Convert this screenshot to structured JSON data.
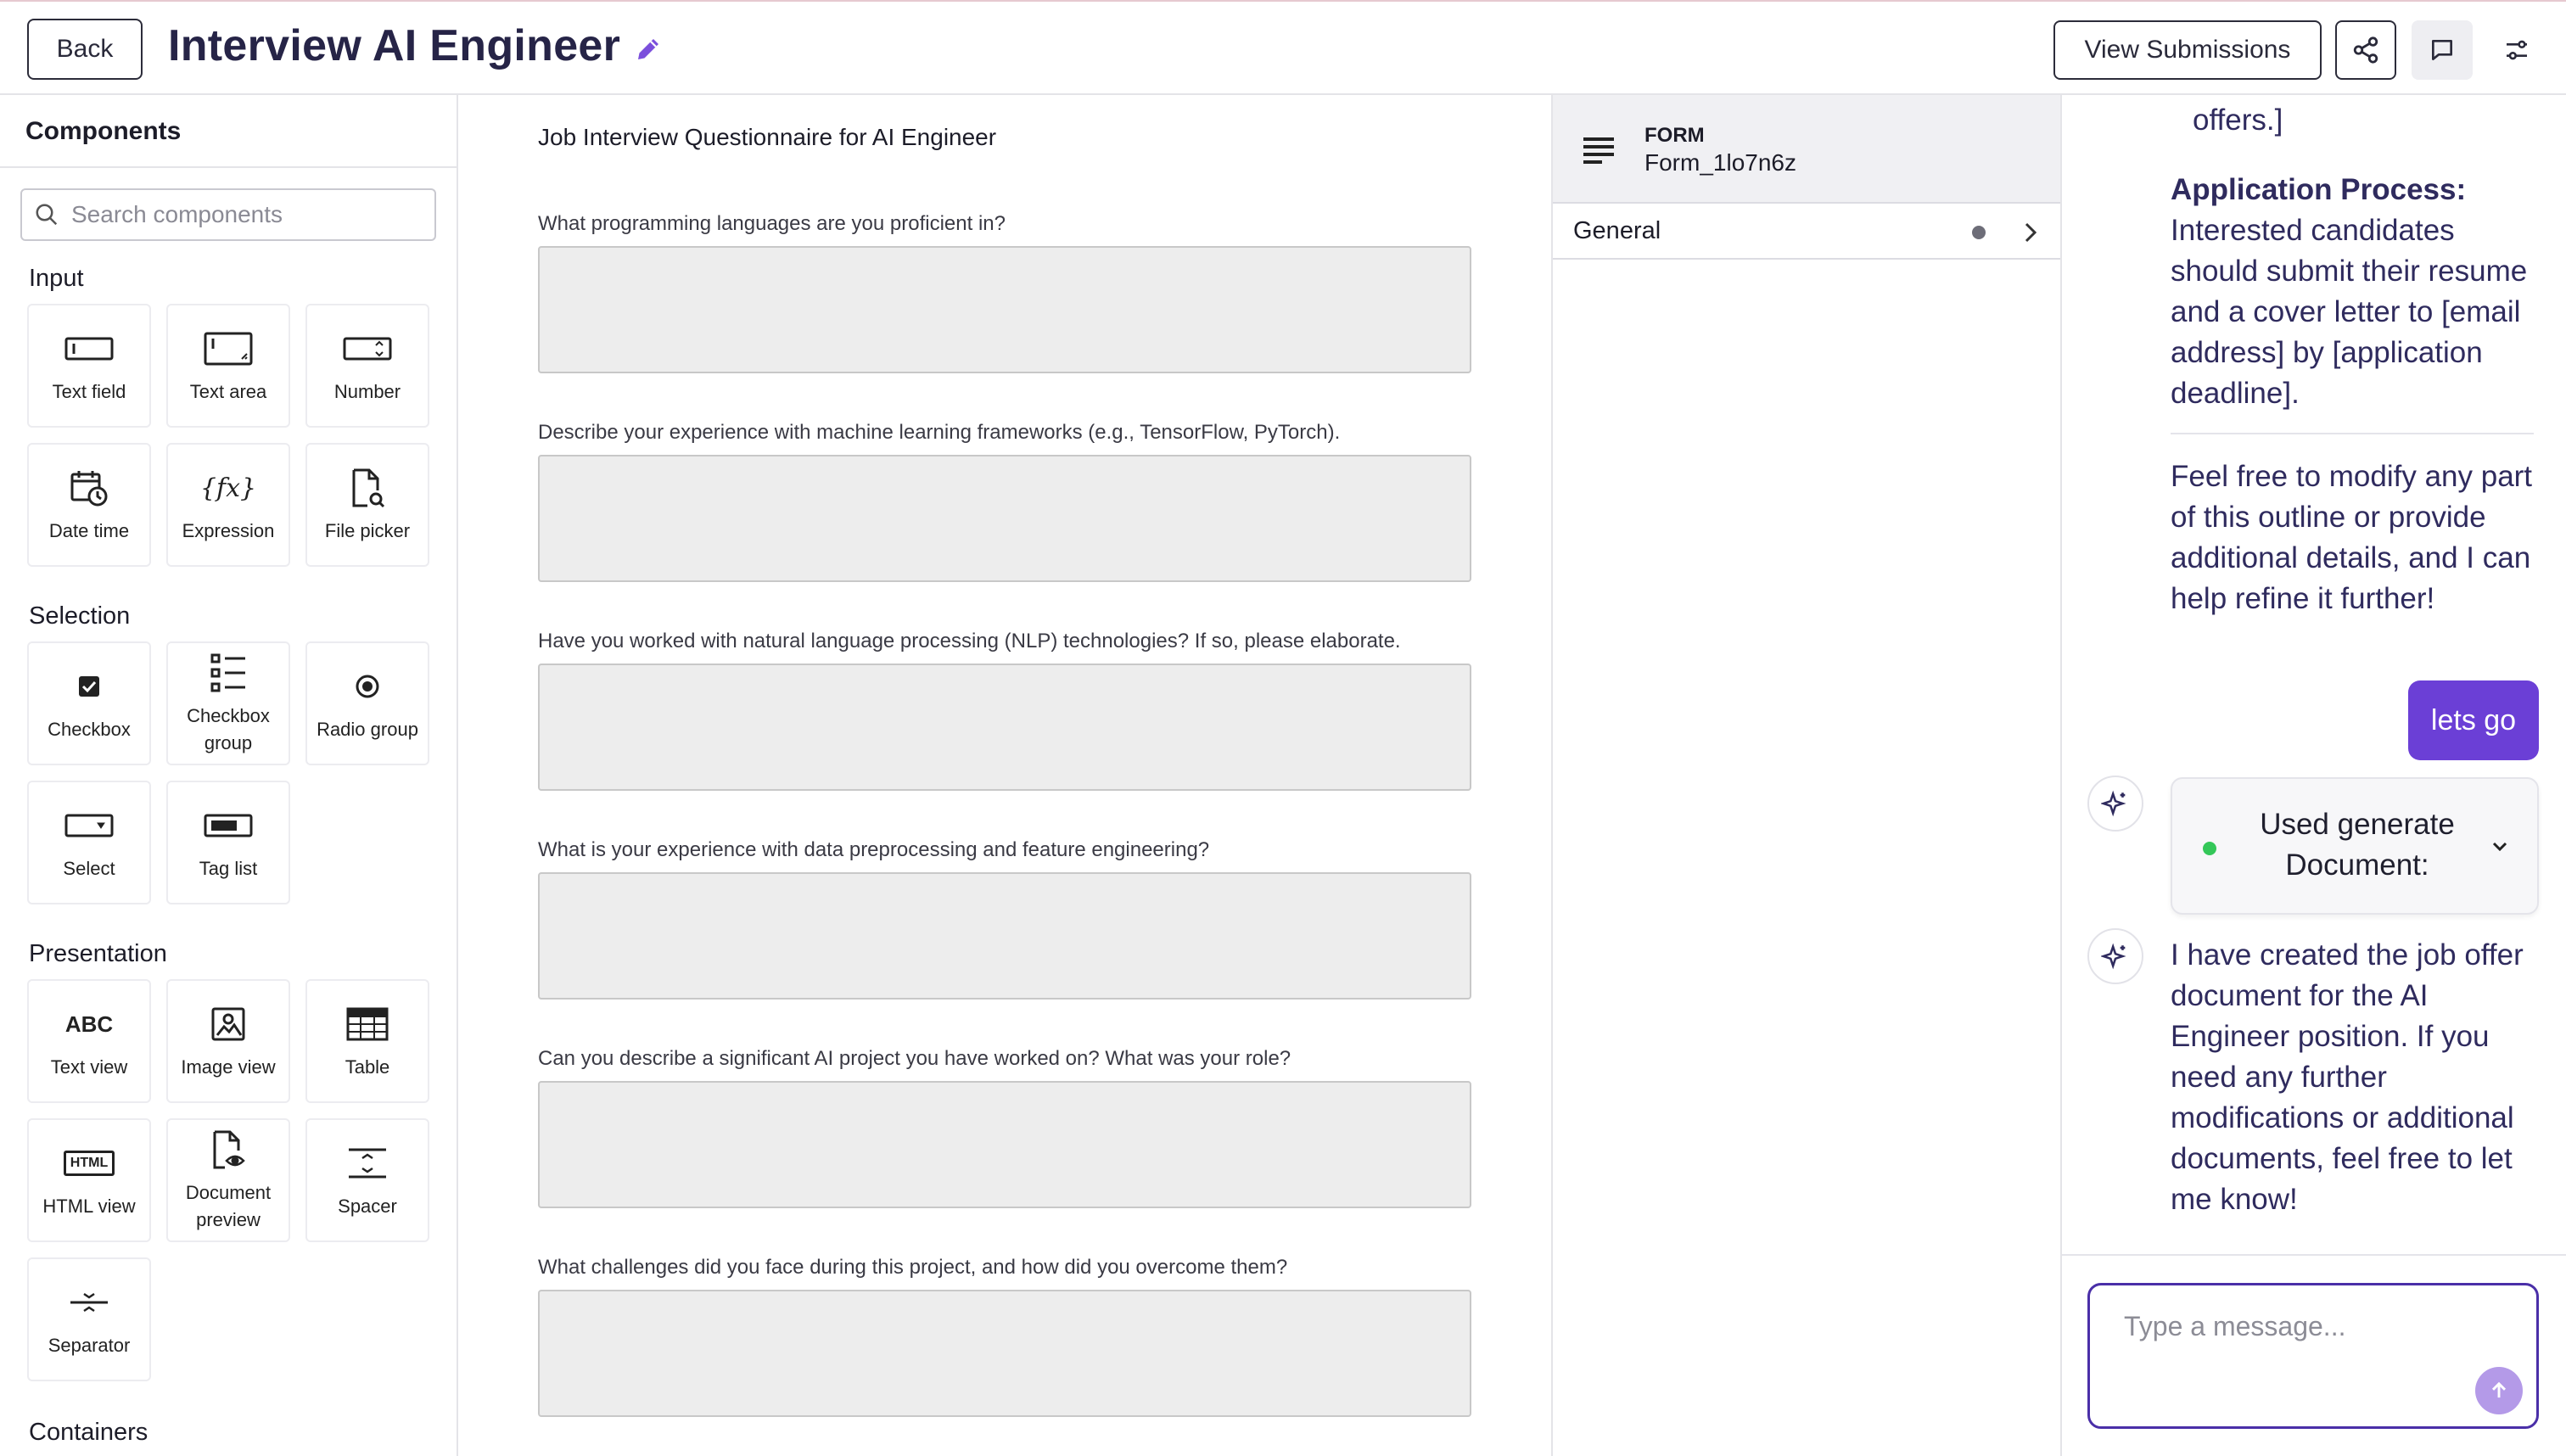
{
  "header": {
    "back_label": "Back",
    "title": "Interview AI Engineer",
    "view_submissions_label": "View Submissions",
    "accent_color": "#7b4fdc"
  },
  "sidebar": {
    "title": "Components",
    "search_placeholder": "Search components",
    "sections": {
      "input": {
        "title": "Input",
        "items": [
          {
            "label": "Text field",
            "icon": "text-field-icon"
          },
          {
            "label": "Text area",
            "icon": "text-area-icon"
          },
          {
            "label": "Number",
            "icon": "number-icon"
          },
          {
            "label": "Date time",
            "icon": "date-time-icon"
          },
          {
            "label": "Expression",
            "icon": "expression-icon"
          },
          {
            "label": "File picker",
            "icon": "file-picker-icon"
          }
        ]
      },
      "selection": {
        "title": "Selection",
        "items": [
          {
            "label": "Checkbox",
            "icon": "checkbox-icon"
          },
          {
            "label": "Checkbox group",
            "icon": "checkbox-group-icon"
          },
          {
            "label": "Radio group",
            "icon": "radio-group-icon"
          },
          {
            "label": "Select",
            "icon": "select-icon"
          },
          {
            "label": "Tag list",
            "icon": "tag-list-icon"
          }
        ]
      },
      "presentation": {
        "title": "Presentation",
        "items": [
          {
            "label": "Text view",
            "icon": "text-view-icon",
            "glyph": "ABC"
          },
          {
            "label": "Image view",
            "icon": "image-view-icon"
          },
          {
            "label": "Table",
            "icon": "table-icon"
          },
          {
            "label": "HTML view",
            "icon": "html-view-icon",
            "glyph": "HTML"
          },
          {
            "label": "Document preview",
            "icon": "document-preview-icon"
          },
          {
            "label": "Spacer",
            "icon": "spacer-icon"
          },
          {
            "label": "Separator",
            "icon": "separator-icon"
          }
        ]
      },
      "containers": {
        "title": "Containers"
      }
    }
  },
  "form": {
    "heading": "Job Interview Questionnaire for AI Engineer",
    "questions": [
      "What programming languages are you proficient in?",
      "Describe your experience with machine learning frameworks (e.g., TensorFlow, PyTorch).",
      "Have you worked with natural language processing (NLP) technologies? If so, please elaborate.",
      "What is your experience with data preprocessing and feature engineering?",
      "Can you describe a significant AI project you have worked on? What was your role?",
      "What challenges did you face during this project, and how did you overcome them?"
    ]
  },
  "properties": {
    "type_label": "FORM",
    "form_id": "Form_1lo7n6z",
    "section_label": "General"
  },
  "chat": {
    "partial_text": "offers.]",
    "application_process_title": "Application Process:",
    "application_process_body": "Interested candidates should submit their resume and a cover letter to [email address] by [application deadline].",
    "feel_free_text": "Feel free to modify any part of this outline or provide additional details, and I can help refine it further!",
    "user_message": "lets go",
    "tool_call_label": "Used generate Document:",
    "tool_status_color": "#34c759",
    "final_message": "I have created the job offer document for the AI Engineer position. If you need any further modifications or additional documents, feel free to let me know!",
    "input_placeholder": "Type a message..."
  }
}
